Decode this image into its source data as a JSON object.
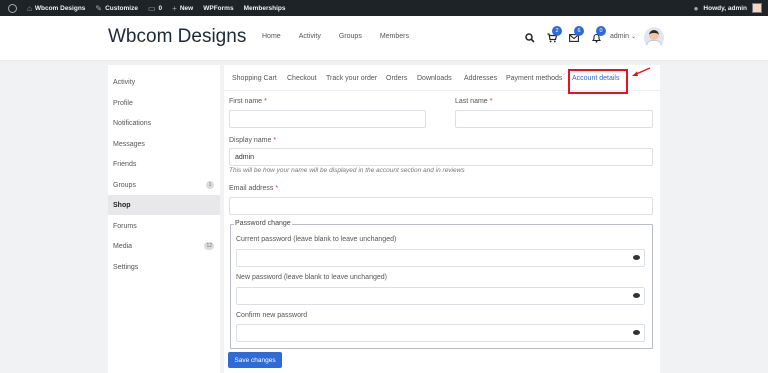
{
  "admin_bar": {
    "site_name": "Wbcom Designs",
    "customize": "Customize",
    "comments_count": "0",
    "new_label": "New",
    "wpforms": "WPForms",
    "memberships": "Memberships",
    "howdy": "Howdy, admin"
  },
  "header": {
    "site_title": "Wbcom Designs",
    "nav": [
      "Home",
      "Activity",
      "Groups",
      "Members"
    ],
    "cart_badge": "2",
    "messages_badge": "6",
    "notifications_badge": "0",
    "user_label": "admin"
  },
  "sidebar": {
    "items": [
      {
        "label": "Activity"
      },
      {
        "label": "Profile"
      },
      {
        "label": "Notifications"
      },
      {
        "label": "Messages"
      },
      {
        "label": "Friends"
      },
      {
        "label": "Groups",
        "count": "1"
      },
      {
        "label": "Shop"
      },
      {
        "label": "Forums"
      },
      {
        "label": "Media",
        "count": "12"
      },
      {
        "label": "Settings"
      }
    ]
  },
  "tabs": [
    "Shopping Cart",
    "Checkout",
    "Track your order",
    "Orders",
    "Downloads",
    "Addresses",
    "Payment methods",
    "Account details"
  ],
  "form": {
    "first_name_label": "First name",
    "last_name_label": "Last name",
    "required_mark": "*",
    "first_name_value": "",
    "last_name_value": "",
    "display_name_label": "Display name",
    "display_name_value": "admin",
    "display_name_hint": "This will be how your name will be displayed in the account section and in reviews",
    "email_label": "Email address",
    "email_value": "",
    "password_legend": "Password change",
    "current_password_label": "Current password (leave blank to leave unchanged)",
    "new_password_label": "New password (leave blank to leave unchanged)",
    "confirm_password_label": "Confirm new password",
    "save_button": "Save changes"
  },
  "colors": {
    "accent": "#2e6ad8",
    "admin_bar": "#1d2327",
    "highlight": "#e3141b"
  }
}
